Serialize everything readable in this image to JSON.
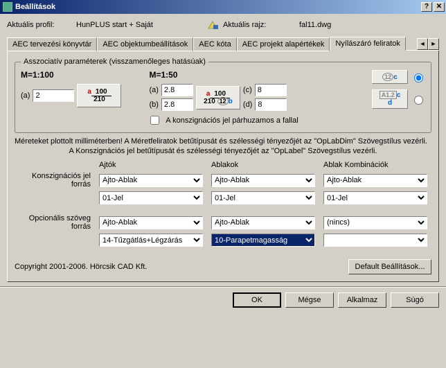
{
  "window": {
    "title": "Beállítások"
  },
  "profile": {
    "current_label": "Aktuális profil:",
    "current_value": "HunPLUS start + Saját",
    "drawing_label": "Aktuális rajz:",
    "drawing_value": "fal11.dwg"
  },
  "tabs": {
    "t0": "AEC tervezési könyvtár",
    "t1": "AEC objektumbeállítások",
    "t2": "AEC kóta",
    "t3": "AEC projekt alapértékek",
    "t4": "Nyílászáró feliratok"
  },
  "group": {
    "legend": "Asszociatív paraméterek (visszamenőleges hatásúak)",
    "m100": "M=1:100",
    "m50": "M=1:50",
    "a": "(a)",
    "b": "(b)",
    "c": "(c)",
    "d": "(d)",
    "val_a100": "2",
    "val_a50": "2.8",
    "val_b50": "2.8",
    "val_c": "8",
    "val_d": "8",
    "ico_top": "100",
    "ico_bot": "210",
    "ico_a": "a",
    "ico_b": "b",
    "ico_c": "c",
    "ico_d": "d",
    "ico_12": "12",
    "ico_a12": "A1.2",
    "chk_label": "A konszignációs jel párhuzamos a fallal"
  },
  "notes": {
    "l1": "Méreteket plottolt milliméterben! A Méretfeliratok betűtípusát és szélességi tényezőjét az \"OpLabDim\" Szövegstílus vezérli.",
    "l2": "A Konszignációs jel betűtípusát és szélességi tényezőjét az \"OpLabel\" Szövegstílus vezérli."
  },
  "table": {
    "hd_ajtok": "Ajtók",
    "hd_ablakok": "Ablakok",
    "hd_kombi": "Ablak Kombinációk",
    "r1_label": "Konszignációs jel forrás",
    "r2_label": "Opcionális szöveg forrás",
    "ajto_ablak": "Ajto-Ablak",
    "jel": "01-Jel",
    "nincs": "(nincs)",
    "tuz": "14-Tűzgátlás+Légzárás",
    "parapet": "10-Parapetmagasság",
    "empty": ""
  },
  "buttons": {
    "defaults": "Default Beállítások...",
    "ok": "OK",
    "cancel": "Mégse",
    "apply": "Alkalmaz",
    "help": "Súgó"
  },
  "copyright": "Copyright 2001-2006. Hörcsik CAD Kft."
}
